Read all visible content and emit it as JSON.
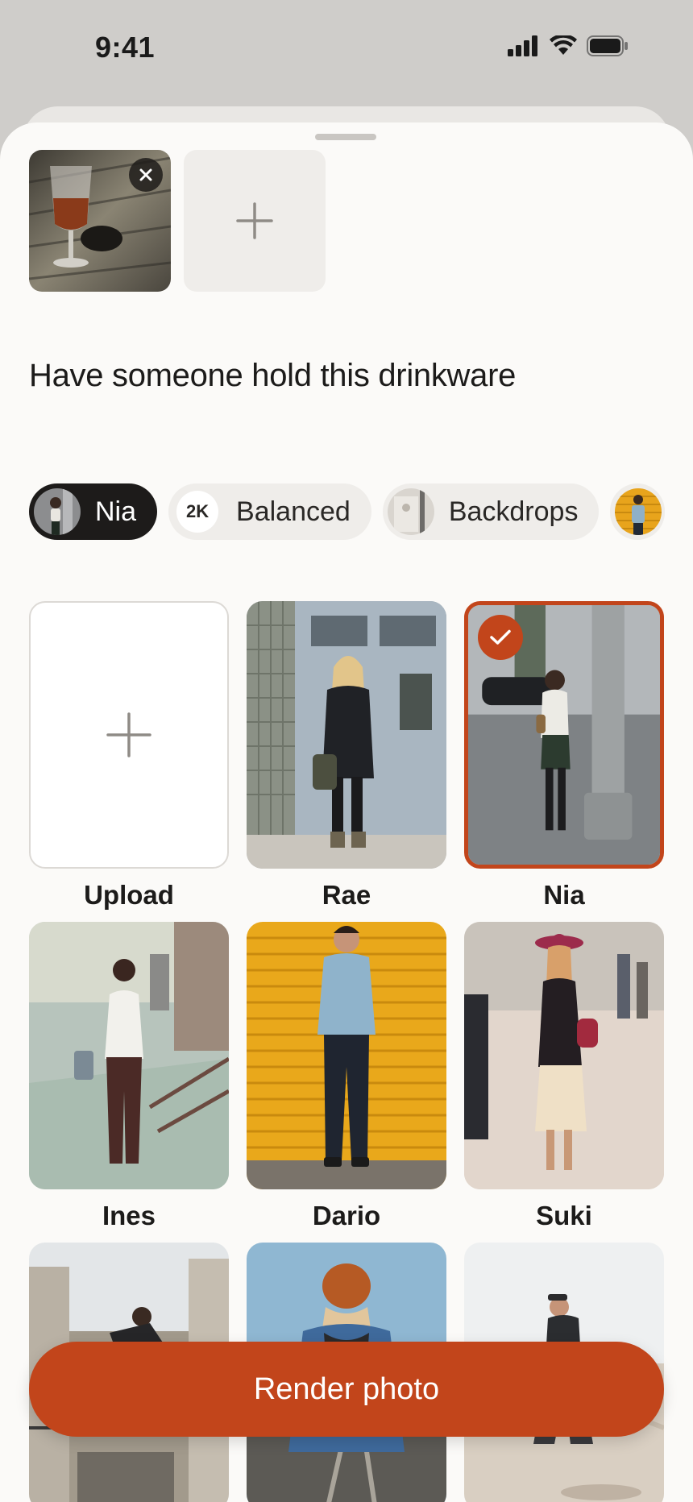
{
  "status_bar": {
    "time": "9:41",
    "icons": [
      "cellular-signal-icon",
      "wifi-icon",
      "battery-icon"
    ]
  },
  "attachments": {
    "items": [
      {
        "subject": "wine glass on wooden table",
        "remove_icon": "close-icon"
      }
    ],
    "add_icon": "plus-icon"
  },
  "prompt": {
    "text": "Have someone hold this drinkware"
  },
  "chips": [
    {
      "label": "Nia",
      "active": true,
      "icon": "avatar"
    },
    {
      "label": "Balanced",
      "badge": "2K",
      "active": false
    },
    {
      "label": "Backdrops",
      "active": false,
      "icon": "backdrop-thumbnail"
    },
    {
      "label": "",
      "active": false,
      "icon": "style-thumbnail"
    }
  ],
  "models": {
    "upload_label": "Upload",
    "items": [
      {
        "name": "Rae",
        "selected": false
      },
      {
        "name": "Nia",
        "selected": true
      },
      {
        "name": "Ines",
        "selected": false
      },
      {
        "name": "Dario",
        "selected": false
      },
      {
        "name": "Suki",
        "selected": false
      }
    ]
  },
  "render_button": {
    "label": "Render photo"
  },
  "colors": {
    "accent": "#c2451b",
    "sheet_background": "#fbfaf8",
    "active_chip": "#1d1b1a"
  }
}
